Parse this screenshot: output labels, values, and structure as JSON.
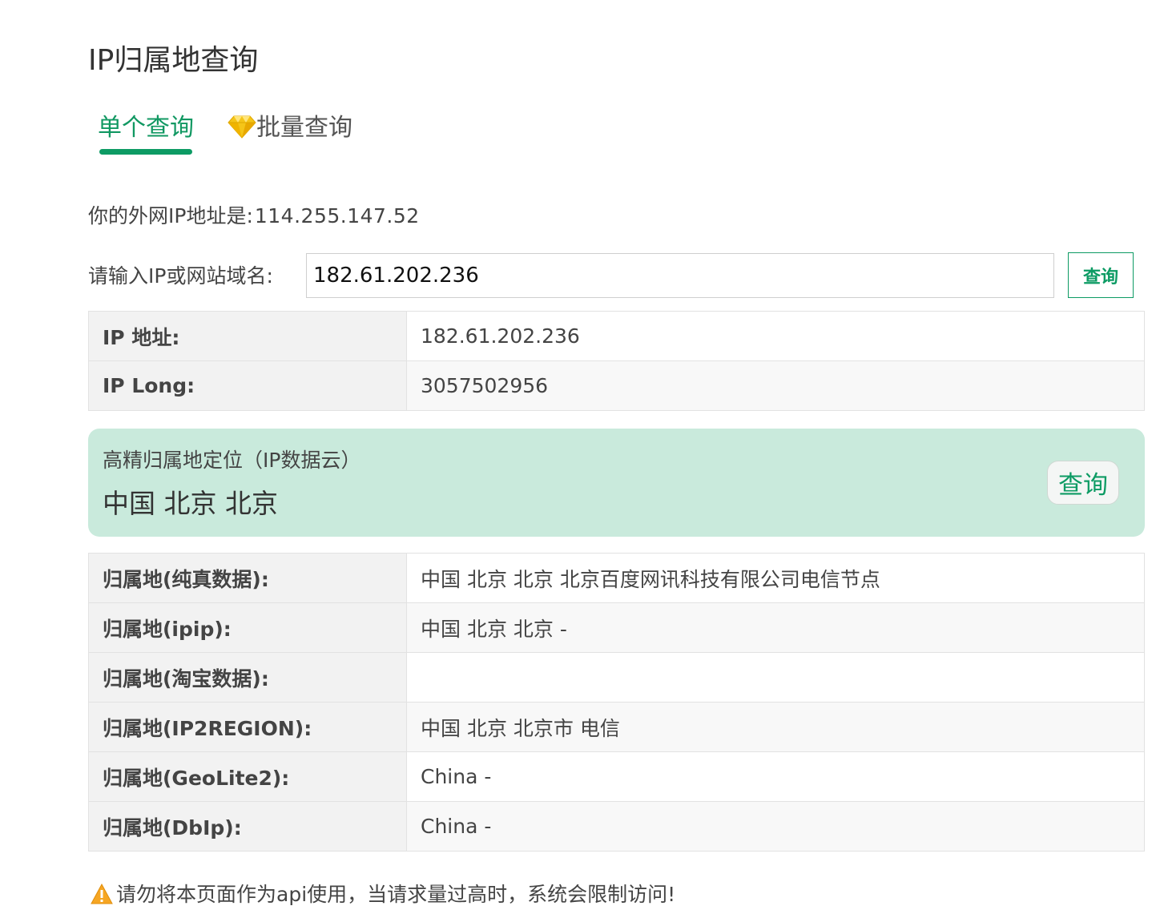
{
  "page": {
    "title": "IP归属地查询"
  },
  "tabs": [
    {
      "label": "单个查询",
      "active": true
    },
    {
      "label": "批量查询",
      "active": false,
      "icon": "diamond-icon"
    }
  ],
  "my_ip": {
    "label": "你的外网IP地址是:",
    "value": "114.255.147.52"
  },
  "query": {
    "label": "请输入IP或网站域名:",
    "input_value": "182.61.202.236",
    "button_label": "查询"
  },
  "basic_info": [
    {
      "key": "IP 地址:",
      "value": "182.61.202.236"
    },
    {
      "key": "IP Long:",
      "value": "3057502956"
    }
  ],
  "precise_location": {
    "label": "高精归属地定位（IP数据云）",
    "value": "中国 北京 北京",
    "button_label": "查询"
  },
  "sources": [
    {
      "key": "归属地(纯真数据):",
      "value": "中国 北京 北京 北京百度网讯科技有限公司电信节点"
    },
    {
      "key": "归属地(ipip):",
      "value": "中国 北京 北京 -"
    },
    {
      "key": "归属地(淘宝数据):",
      "value": ""
    },
    {
      "key": "归属地(IP2REGION):",
      "value": "中国 北京 北京市 电信"
    },
    {
      "key": "归属地(GeoLite2):",
      "value": "China -"
    },
    {
      "key": "归属地(DbIp):",
      "value": "China -"
    }
  ],
  "warning": {
    "icon": "warning-icon",
    "text": "请勿将本页面作为api使用，当请求量过高时，系统会限制访问!"
  },
  "colors": {
    "accent": "#0d9b64",
    "card_background": "#c9eadc"
  }
}
